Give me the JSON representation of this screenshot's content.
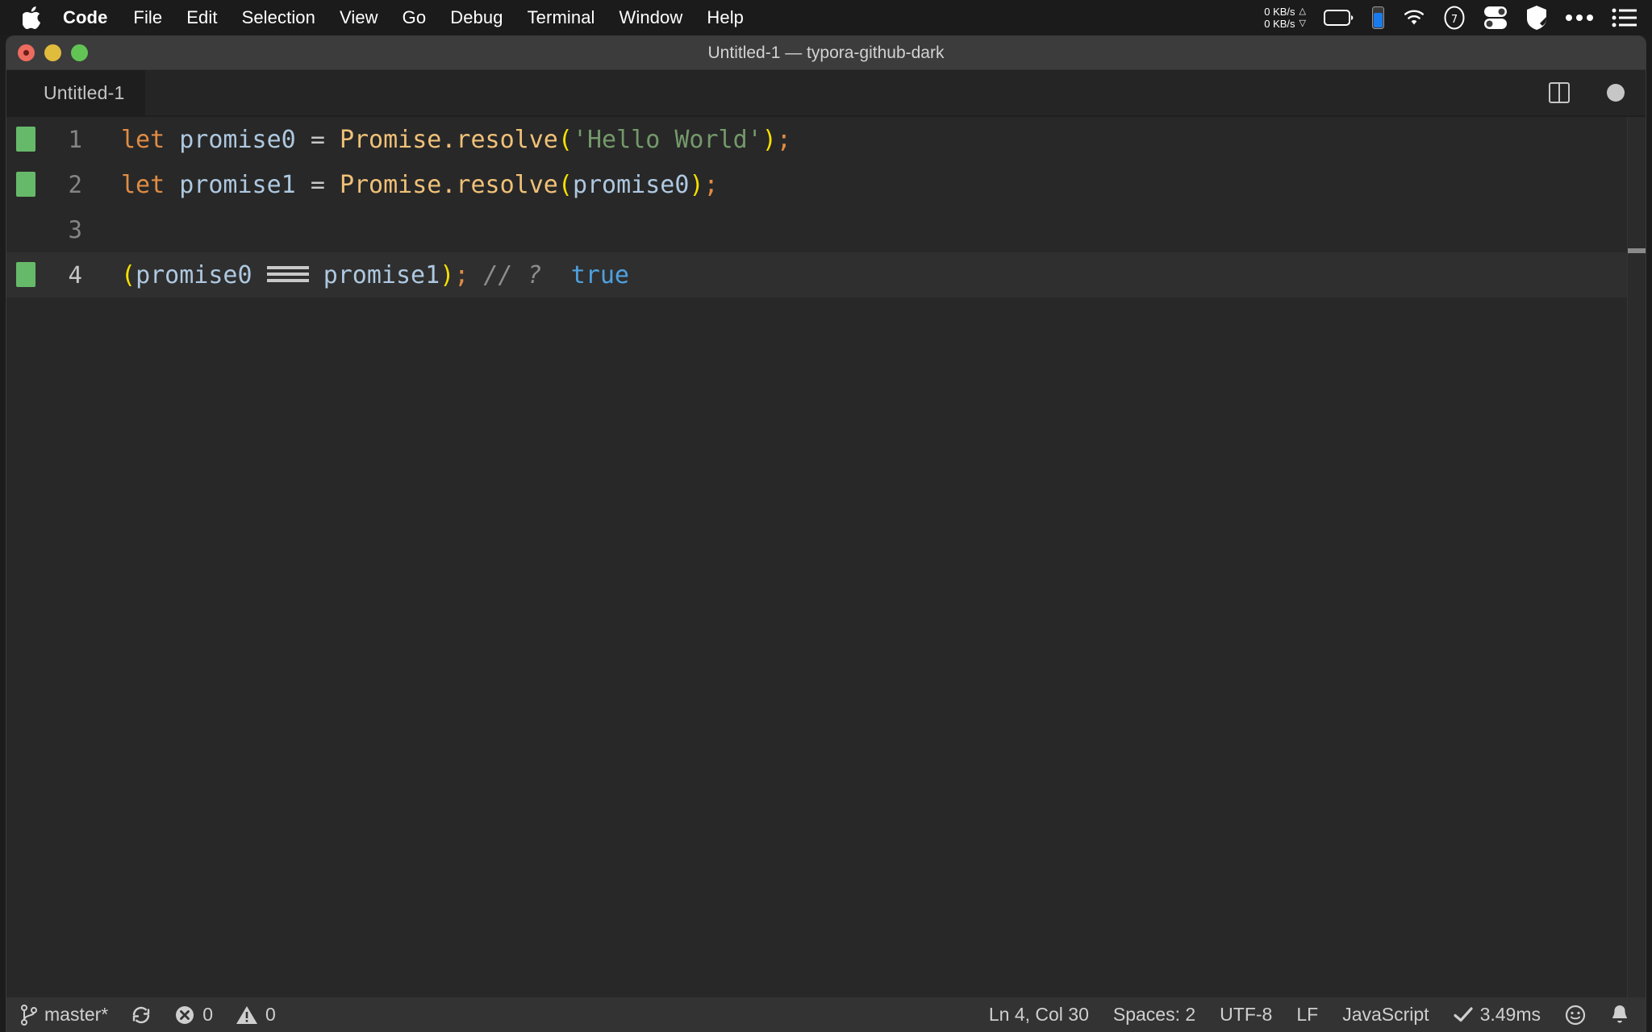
{
  "menubar": {
    "apple_icon": "apple-logo-icon",
    "items": [
      {
        "label": "Code",
        "bold": true
      },
      {
        "label": "File",
        "bold": false
      },
      {
        "label": "Edit",
        "bold": false
      },
      {
        "label": "Selection",
        "bold": false
      },
      {
        "label": "View",
        "bold": false
      },
      {
        "label": "Go",
        "bold": false
      },
      {
        "label": "Debug",
        "bold": false
      },
      {
        "label": "Terminal",
        "bold": false
      },
      {
        "label": "Window",
        "bold": false
      },
      {
        "label": "Help",
        "bold": false
      }
    ],
    "network": {
      "upload": "0 KB/s",
      "download": "0 KB/s",
      "up_arrow": "△",
      "down_arrow": "▽"
    },
    "status_icons": [
      "battery-icon",
      "battery-level-icon",
      "wifi-icon",
      "timer-circle-icon",
      "toggles-icon",
      "shield-icon",
      "ellipsis-icon",
      "control-center-icon"
    ]
  },
  "window": {
    "title": "Untitled-1 — typora-github-dark",
    "traffic_lights": [
      "close-button",
      "minimize-button",
      "maximize-button"
    ]
  },
  "tabstrip": {
    "tab_label": "Untitled-1",
    "split_editor_icon": "split-editor-icon",
    "unsaved_dot": "unsaved-indicator-icon"
  },
  "editor": {
    "language": "JavaScript",
    "lines": [
      {
        "number": "1",
        "git_marker": true,
        "active": false,
        "tokens": [
          {
            "t": "let",
            "c": "t-key"
          },
          {
            "t": " ",
            "c": "t-op"
          },
          {
            "t": "promise0",
            "c": "t-var"
          },
          {
            "t": " ",
            "c": "t-op"
          },
          {
            "t": "=",
            "c": "t-op"
          },
          {
            "t": " ",
            "c": "t-op"
          },
          {
            "t": "Promise.resolve",
            "c": "t-fn"
          },
          {
            "t": "(",
            "c": "t-paren"
          },
          {
            "t": "'Hello World'",
            "c": "t-str"
          },
          {
            "t": ")",
            "c": "t-paren"
          },
          {
            "t": ";",
            "c": "t-punc"
          }
        ]
      },
      {
        "number": "2",
        "git_marker": true,
        "active": false,
        "tokens": [
          {
            "t": "let",
            "c": "t-key"
          },
          {
            "t": " ",
            "c": "t-op"
          },
          {
            "t": "promise1",
            "c": "t-var"
          },
          {
            "t": " ",
            "c": "t-op"
          },
          {
            "t": "=",
            "c": "t-op"
          },
          {
            "t": " ",
            "c": "t-op"
          },
          {
            "t": "Promise.resolve",
            "c": "t-fn"
          },
          {
            "t": "(",
            "c": "t-paren"
          },
          {
            "t": "promise0",
            "c": "t-var"
          },
          {
            "t": ")",
            "c": "t-paren"
          },
          {
            "t": ";",
            "c": "t-punc"
          }
        ]
      },
      {
        "number": "3",
        "git_marker": false,
        "active": false,
        "tokens": []
      },
      {
        "number": "4",
        "git_marker": true,
        "active": true,
        "tokens": [
          {
            "t": "(",
            "c": "t-paren"
          },
          {
            "t": "promise0",
            "c": "t-var"
          },
          {
            "t": " ",
            "c": "t-op"
          },
          {
            "t": "===",
            "c": "t-op",
            "ligature": true
          },
          {
            "t": " ",
            "c": "t-op"
          },
          {
            "t": "promise1",
            "c": "t-var"
          },
          {
            "t": ")",
            "c": "t-paren"
          },
          {
            "t": ";",
            "c": "t-punc"
          },
          {
            "t": " ",
            "c": "t-op"
          },
          {
            "t": "// ?",
            "c": "t-cmt"
          },
          {
            "t": "  ",
            "c": "t-op"
          },
          {
            "t": "true",
            "c": "t-bool"
          }
        ]
      }
    ],
    "colors": {
      "background": "#282828",
      "active_line": "#2f2f2f",
      "keyword": "#e08c45",
      "variable": "#aec8e0",
      "function": "#f0c178",
      "paren": "#f5e000",
      "string": "#74996b",
      "comment": "#8d8d8d",
      "boolean": "#4ea1e0",
      "git_added": "#67b96a",
      "line_number": "#858585"
    }
  },
  "statusbar": {
    "left": [
      {
        "name": "git-branch",
        "icon": "git-branch-icon",
        "label": "master*"
      },
      {
        "name": "sync-changes",
        "icon": "sync-icon",
        "label": ""
      },
      {
        "name": "errors",
        "icon": "error-icon",
        "label": "0"
      },
      {
        "name": "warnings",
        "icon": "warning-icon",
        "label": "0"
      }
    ],
    "right": [
      {
        "name": "cursor-position",
        "icon": "",
        "label": "Ln 4, Col 30"
      },
      {
        "name": "indentation",
        "icon": "",
        "label": "Spaces: 2"
      },
      {
        "name": "encoding",
        "icon": "",
        "label": "UTF-8"
      },
      {
        "name": "line-endings",
        "icon": "",
        "label": "LF"
      },
      {
        "name": "language-mode",
        "icon": "",
        "label": "JavaScript"
      },
      {
        "name": "quokka-runtime",
        "icon": "checkmark-icon",
        "label": "3.49ms"
      },
      {
        "name": "feedback",
        "icon": "smiley-icon",
        "label": ""
      },
      {
        "name": "notifications",
        "icon": "bell-icon",
        "label": ""
      }
    ]
  }
}
